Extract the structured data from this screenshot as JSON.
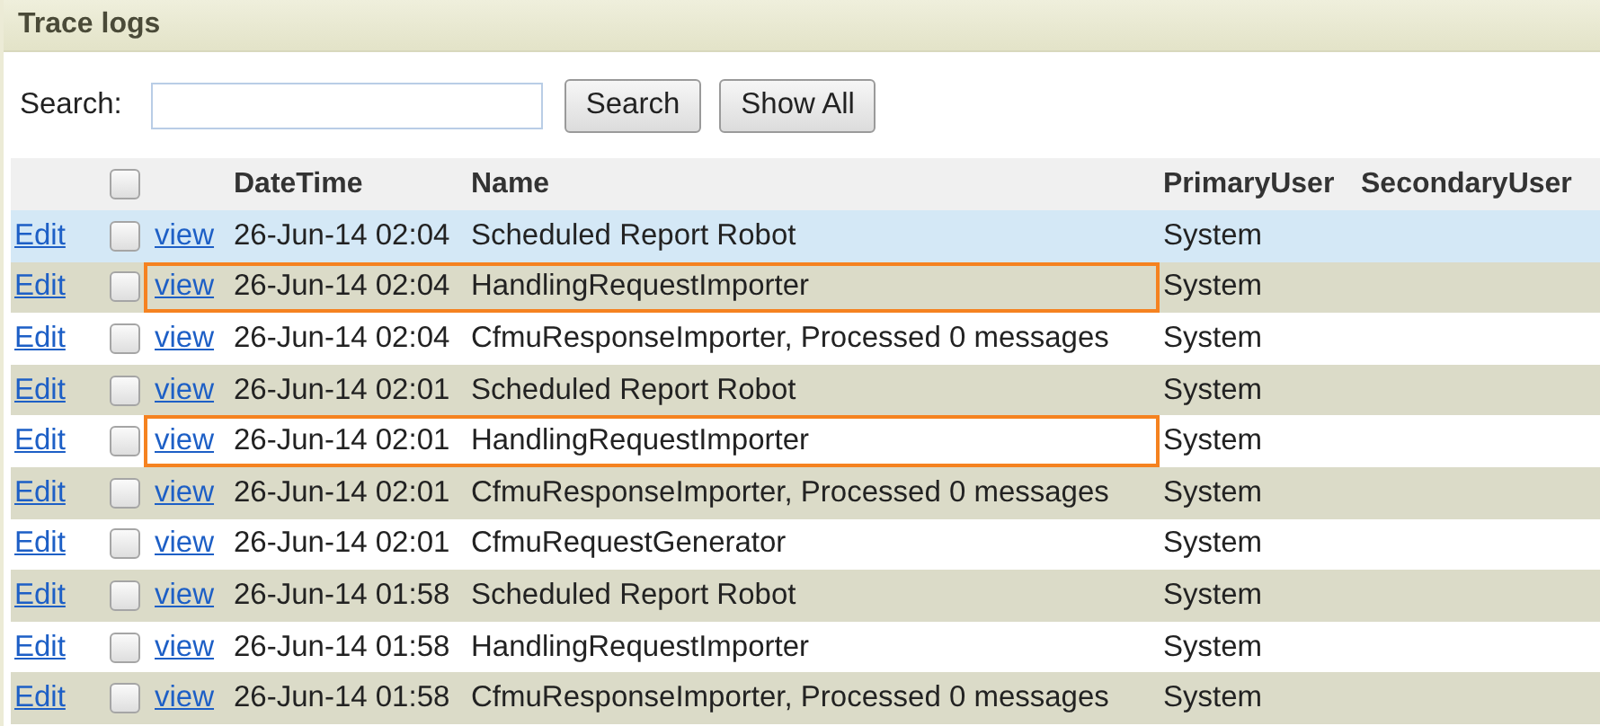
{
  "panel": {
    "title": "Trace logs"
  },
  "search": {
    "label": "Search:",
    "buttons": [
      "Search",
      "Show All"
    ]
  },
  "table": {
    "columns": [
      "DateTime",
      "Name",
      "PrimaryUser",
      "SecondaryUser"
    ],
    "header_checked": false,
    "rows": [
      {
        "edit": "Edit",
        "checked": false,
        "view": "view",
        "datetime": "26-Jun-14 02:04",
        "name": "Scheduled Report Robot",
        "primary_user": "System",
        "selected": true,
        "highlighted": false
      },
      {
        "edit": "Edit",
        "checked": false,
        "view": "view",
        "datetime": "26-Jun-14 02:04",
        "name": "HandlingRequestImporter",
        "primary_user": "System",
        "selected": false,
        "highlighted": true
      },
      {
        "edit": "Edit",
        "checked": false,
        "view": "view",
        "datetime": "26-Jun-14 02:04",
        "name": "CfmuResponseImporter, Processed 0 messages",
        "primary_user": "System",
        "selected": false,
        "highlighted": false
      },
      {
        "edit": "Edit",
        "checked": false,
        "view": "view",
        "datetime": "26-Jun-14 02:01",
        "name": "Scheduled Report Robot",
        "primary_user": "System",
        "selected": false,
        "highlighted": false
      },
      {
        "edit": "Edit",
        "checked": false,
        "view": "view",
        "datetime": "26-Jun-14 02:01",
        "name": "HandlingRequestImporter",
        "primary_user": "System",
        "selected": false,
        "highlighted": true
      },
      {
        "edit": "Edit",
        "checked": false,
        "view": "view",
        "datetime": "26-Jun-14 02:01",
        "name": "CfmuResponseImporter, Processed 0 messages",
        "primary_user": "System",
        "selected": false,
        "highlighted": false
      },
      {
        "edit": "Edit",
        "checked": false,
        "view": "view",
        "datetime": "26-Jun-14 02:01",
        "name": "CfmuRequestGenerator",
        "primary_user": "System",
        "selected": false,
        "highlighted": false
      },
      {
        "edit": "Edit",
        "checked": false,
        "view": "view",
        "datetime": "26-Jun-14 01:58",
        "name": "Scheduled Report Robot",
        "primary_user": "System",
        "selected": false,
        "highlighted": false
      },
      {
        "edit": "Edit",
        "checked": false,
        "view": "view",
        "datetime": "26-Jun-14 01:58",
        "name": "HandlingRequestImporter",
        "primary_user": "System",
        "selected": false,
        "highlighted": false
      },
      {
        "edit": "Edit",
        "checked": false,
        "view": "view",
        "datetime": "26-Jun-14 01:58",
        "name": "CfmuResponseImporter, Processed 0 messages",
        "primary_user": "System",
        "selected": false,
        "highlighted": false
      }
    ]
  }
}
